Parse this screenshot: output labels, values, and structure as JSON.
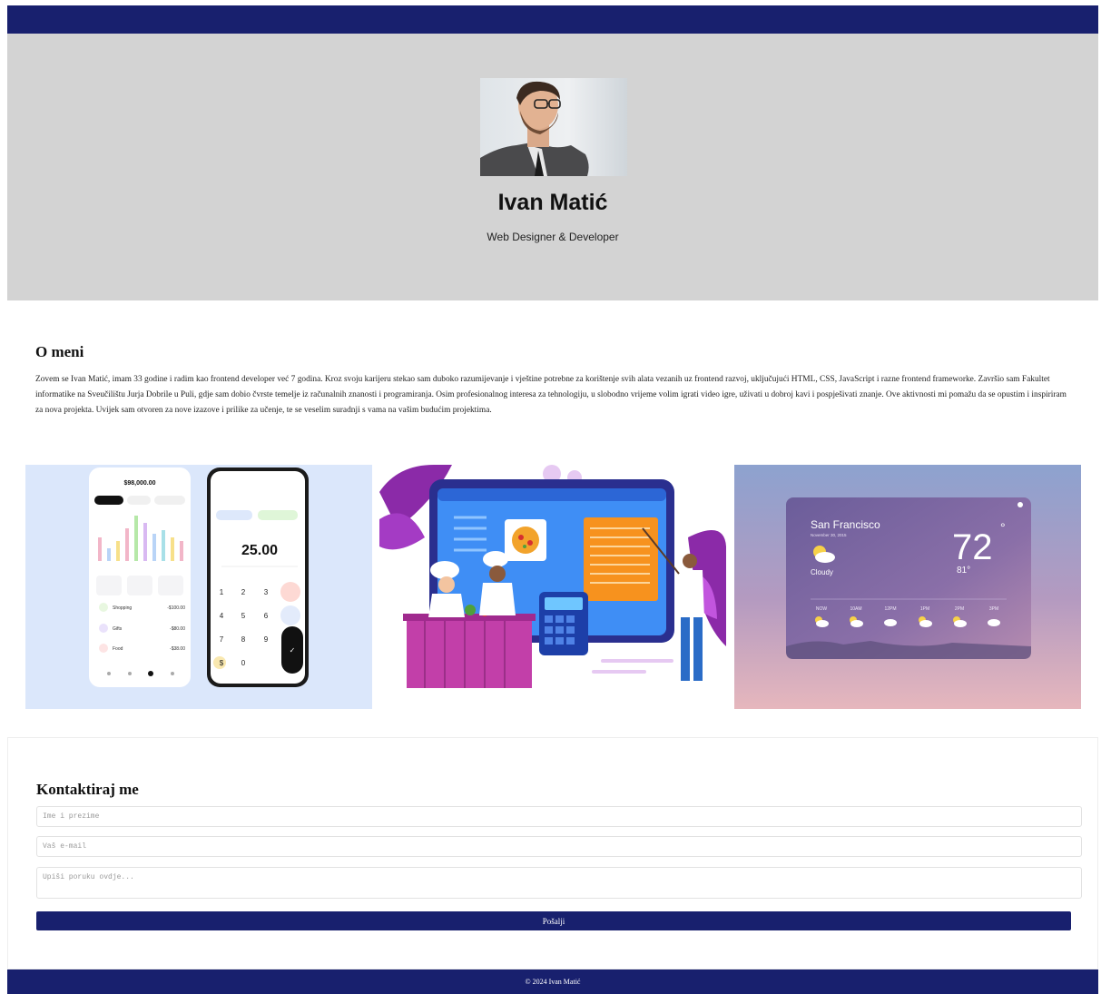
{
  "nav": {
    "links": [
      "",
      ""
    ]
  },
  "hero": {
    "name": "Ivan Matić",
    "subtitle": "Web Designer & Developer"
  },
  "about": {
    "title": "O meni",
    "text": "Zovem se Ivan Matić, imam 33 godine i radim kao frontend developer već 7 godina. Kroz svoju karijeru stekao sam duboko razumijevanje i vještine potrebne za korištenje svih alata vezanih uz frontend razvoj, uključujući HTML, CSS, JavaScript i razne frontend frameworke. Završio sam Fakultet informatike na Sveučilištu Jurja Dobrile u Puli, gdje sam dobio čvrste temelje iz računalnih znanosti i programiranja. Osim profesionalnog interesa za tehnologiju, u slobodno vrijeme volim igrati video igre, uživati u dobroj kavi i pospješivati znanje. Ove aktivnosti mi pomažu da se opustim i inspiriram za nova projekta. Uvijek sam otvoren za nove izazove i prilike za učenje, te se veselim suradnji s vama na vašim budućim projektima."
  },
  "gallery": {
    "finance": {
      "balance": "$98,000.00",
      "amount": "25.00",
      "tx": [
        {
          "label": "Shopping",
          "value": "-$100.00"
        },
        {
          "label": "Gifts",
          "value": "-$80.00"
        },
        {
          "label": "Food",
          "value": "-$38.00"
        }
      ],
      "keys": [
        "1",
        "2",
        "3",
        "4",
        "5",
        "6",
        "7",
        "8",
        "9",
        "$",
        "0",
        "✓"
      ]
    },
    "weather": {
      "city": "San Francisco",
      "date": "November 30, 2015",
      "temp": "72",
      "condition": "Cloudy",
      "feels": "81°",
      "hours": [
        "NOW",
        "10AM",
        "12PM",
        "1PM",
        "2PM",
        "3PM"
      ]
    }
  },
  "contact": {
    "title": "Kontaktiraj me",
    "name_placeholder": "Ime i prezime",
    "email_placeholder": "Vaš e-mail",
    "message_placeholder": "Upiši poruku ovdje...",
    "send_label": "Pošalji"
  },
  "footer": {
    "text": "© 2024 Ivan Matić"
  },
  "colors": {
    "navy": "#18206e",
    "hero_bg": "#d3d3d3"
  }
}
